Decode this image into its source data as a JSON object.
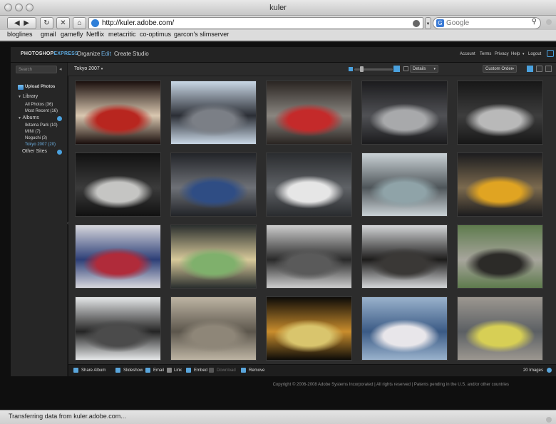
{
  "window": {
    "title": "kuler"
  },
  "browser": {
    "url": "http://kuler.adobe.com/",
    "search_placeholder": "Google",
    "bookmarks": [
      "bloglines",
      "gmail",
      "gamefly",
      "Netflix",
      "metacritic",
      "co-optimus",
      "garcon's slimserver"
    ],
    "status": "Transferring data from kuler.adobe.com..."
  },
  "app": {
    "logo_main": "PHOTOSHOP",
    "logo_accent": "EXPRESS",
    "nav": [
      "Organize",
      "Edit",
      "Create",
      "Studio"
    ],
    "nav_active": "Edit",
    "header_links": [
      "Account",
      "Terms",
      "Privacy",
      "Help",
      "Logout"
    ],
    "search_placeholder": "Search",
    "album_selector": "Tokyo 2007",
    "details_dropdown": "Details",
    "sort_dropdown": "Custom Order",
    "sidebar": {
      "upload": "Upload Photos",
      "library": "Library",
      "all_photos": "All Photos (36)",
      "most_recent": "Most Recent (16)",
      "albums": "Albums",
      "album_items": [
        "Ikitama Park (10)",
        "MINI (7)",
        "Noguchi (3)",
        "Tokyo 2007 (20)"
      ],
      "other_sites": "Other Sites"
    },
    "actions": [
      "Share Album",
      "Slideshow",
      "Email",
      "Link",
      "Embed",
      "Download",
      "Remove"
    ],
    "image_count": "20 Images",
    "copyright": "Copyright © 2006-2008 Adobe Systems Incorporated | All rights reserved | Patents pending in the U.S. and/or other countries"
  },
  "photos": [
    {
      "subject": "red sports car on show floor",
      "colors": [
        "#1a0f0d",
        "#b8261f",
        "#d9c7b0"
      ]
    },
    {
      "subject": "Tokyo city buildings",
      "colors": [
        "#c9d7e5",
        "#7b7f86",
        "#2b2e35"
      ]
    },
    {
      "subject": "red Audi at show",
      "colors": [
        "#2a2522",
        "#c42a2a",
        "#8a8680"
      ]
    },
    {
      "subject": "silver Audi R8",
      "colors": [
        "#1b1b1d",
        "#a8a9ab",
        "#505155"
      ]
    },
    {
      "subject": "silver Audi R8 rear",
      "colors": [
        "#171717",
        "#b9b9b9",
        "#3d3d3d"
      ]
    },
    {
      "subject": "Maserati display",
      "colors": [
        "#111",
        "#c5c5c3",
        "#3b3b3b"
      ]
    },
    {
      "subject": "blue Mini Cooper",
      "colors": [
        "#222428",
        "#2f4d84",
        "#6e7177"
      ]
    },
    {
      "subject": "white concept car",
      "colors": [
        "#2a2c2f",
        "#e6e6e6",
        "#5f6266"
      ]
    },
    {
      "subject": "concept car with model",
      "colors": [
        "#cad2d6",
        "#8fa3a8",
        "#4e5559"
      ]
    },
    {
      "subject": "yellow compact car",
      "colors": [
        "#1c1c1e",
        "#e0a422",
        "#7b6a4f"
      ]
    },
    {
      "subject": "Tokyo Motor Show 2007 sign",
      "colors": [
        "#d7d7dd",
        "#b02b3a",
        "#2d3f77"
      ]
    },
    {
      "subject": "vending machine",
      "colors": [
        "#2b2f2e",
        "#7fb06c",
        "#d7c99a"
      ]
    },
    {
      "subject": "temple roof tiles",
      "colors": [
        "#cdcdcd",
        "#5a5a5a",
        "#2a2a2a"
      ]
    },
    {
      "subject": "pagoda roof against sky",
      "colors": [
        "#d4d6d8",
        "#3a3836",
        "#1d1c1b"
      ]
    },
    {
      "subject": "temple roof and trees",
      "colors": [
        "#5e7b4d",
        "#2c2b28",
        "#a7a59c"
      ]
    },
    {
      "subject": "tiled roof ridge",
      "colors": [
        "#e5e7e8",
        "#4b4b4b",
        "#242424"
      ]
    },
    {
      "subject": "stone wall",
      "colors": [
        "#bdb4a3",
        "#8e8678",
        "#5c564c"
      ]
    },
    {
      "subject": "two drink bottles",
      "colors": [
        "#0d0b08",
        "#d9c56d",
        "#c98d2d"
      ]
    },
    {
      "subject": "Mount Fuji with blossoms",
      "colors": [
        "#9ab2cc",
        "#e8e6ea",
        "#3a5a85"
      ]
    },
    {
      "subject": "silver Mini in parking lot",
      "colors": [
        "#9c9790",
        "#d7cf55",
        "#5b5f63"
      ]
    }
  ]
}
